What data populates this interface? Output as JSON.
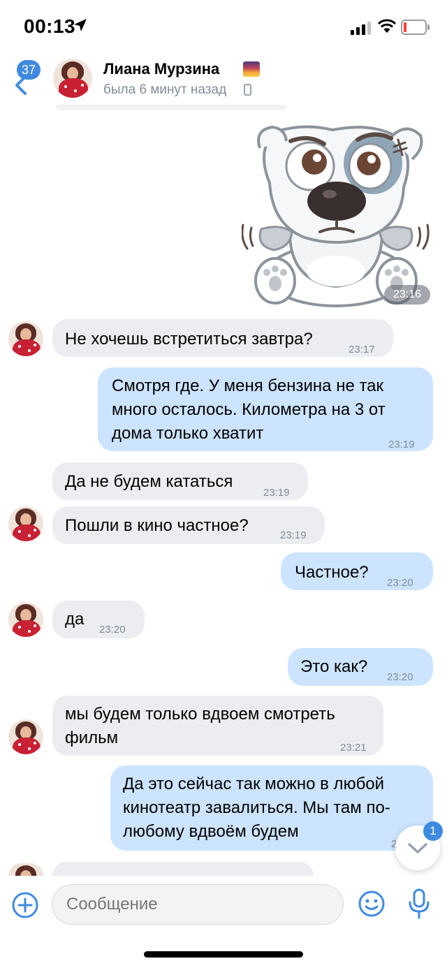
{
  "status_bar": {
    "time": "00:13"
  },
  "header": {
    "back_badge": "37",
    "name": "Лиана Мурзина",
    "status": "была 6 минут назад"
  },
  "messages": [
    {
      "text": "",
      "time": "23:16"
    },
    {
      "text": "Не хочешь встретиться завтра?",
      "time": "23:17"
    },
    {
      "text": "Смотря где. У меня бензина не так\nмного осталось. Километра на 3 от\nдома только хватит",
      "time": "23:19"
    },
    {
      "text": "Да не будем кататься",
      "time": "23:19"
    },
    {
      "text": "Пошли в кино частное?",
      "time": "23:19"
    },
    {
      "text": "Частное?",
      "time": "23:20"
    },
    {
      "text": "да",
      "time": "23:20"
    },
    {
      "text": "Это как?",
      "time": "23:20"
    },
    {
      "text": "мы будем только вдвоем смотреть\nфильм",
      "time": "23:21"
    },
    {
      "text": "Да это сейчас так можно в любой\nкинотеатр завалиться. Мы там по-\nлюбому вдвоём будем",
      "time": "2"
    }
  ],
  "scroll_down_badge": "1",
  "composer": {
    "placeholder": "Сообщение"
  }
}
